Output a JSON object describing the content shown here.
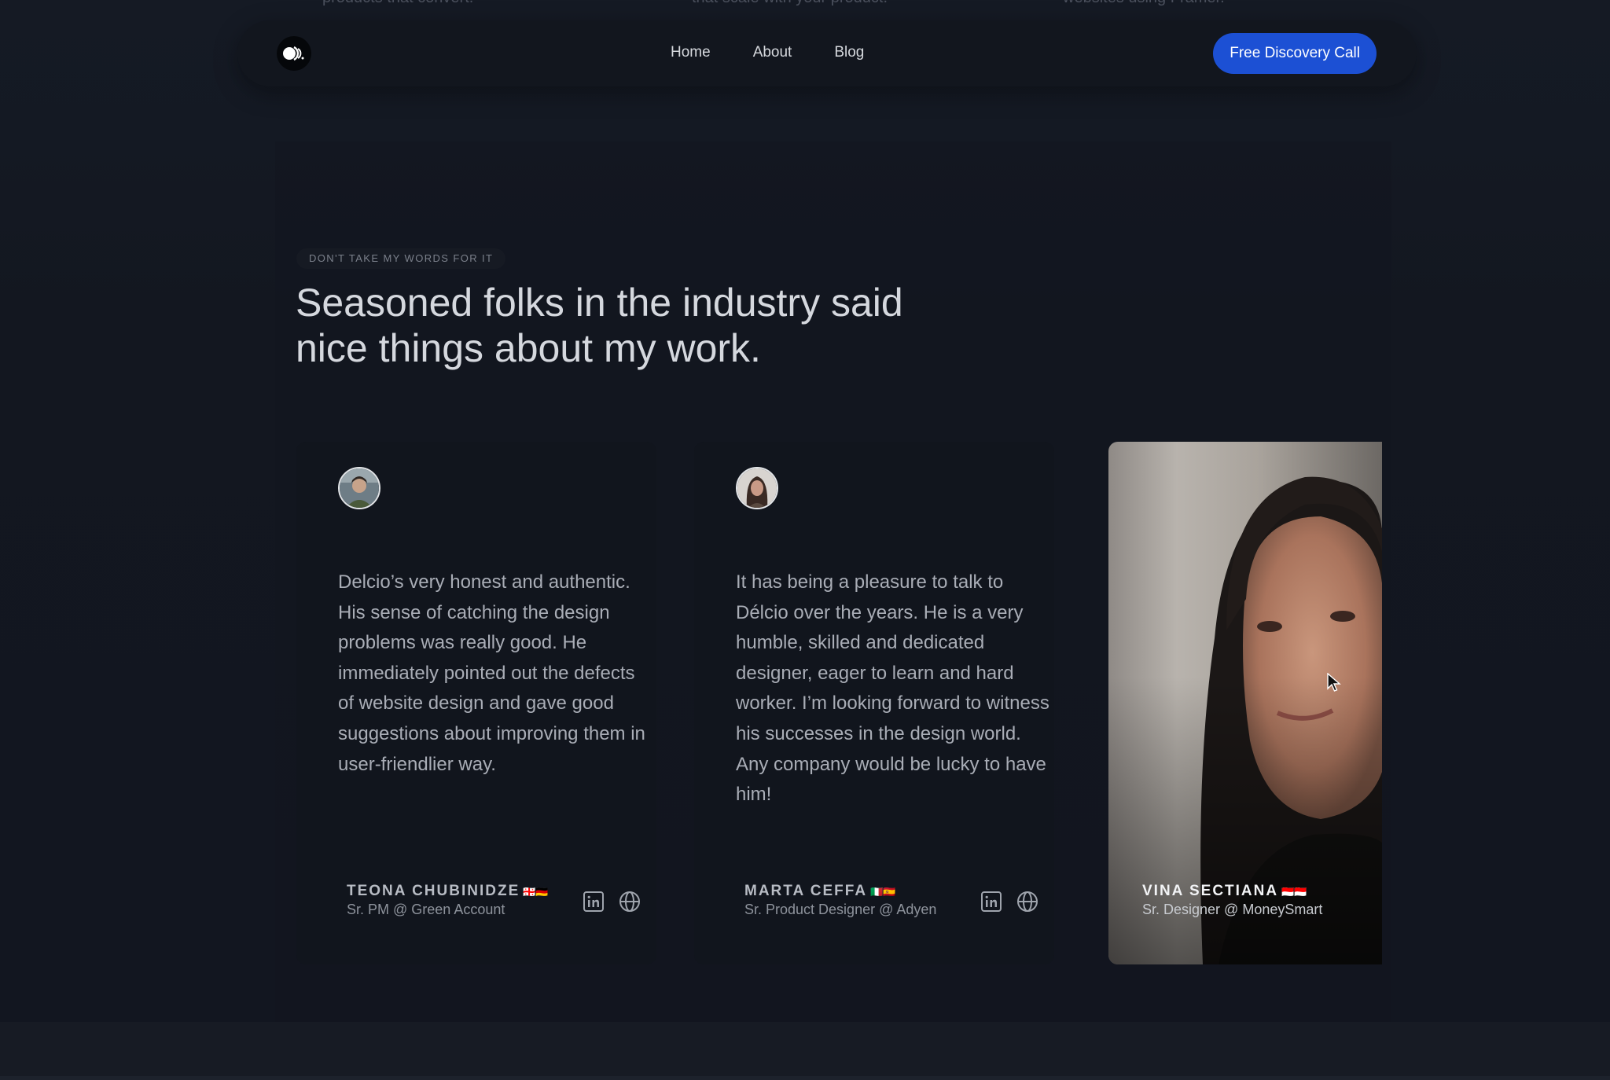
{
  "top_strip": {
    "text_1": "products that convert.",
    "text_2": "that scale with your product.",
    "text_3": "websites using Framer."
  },
  "nav": {
    "logo_icon": "brand-logo-icon",
    "links": [
      "Home",
      "About",
      "Blog"
    ],
    "cta_label": "Free Discovery Call",
    "cta_color": "#1c50d4"
  },
  "section": {
    "eyebrow": "DON'T TAKE MY WORDS FOR IT",
    "headline_line1": "Seasoned folks in the industry said",
    "headline_line2": "nice things about my work."
  },
  "testimonials": [
    {
      "quote": "Delcio’s very honest and authentic. His sense of catching the design problems was really good. He immediately pointed out the defects of website design and gave good suggestions about improving them in user-friendlier way.",
      "name": "TEONA CHUBINIDZE",
      "flags": "🇬🇪🇩🇪",
      "role": "Sr. PM @ Green Account",
      "icons": [
        "linkedin-icon",
        "globe-icon"
      ]
    },
    {
      "quote": "It has being a pleasure to talk to Délcio over the years. He is a very humble, skilled and dedicated designer, eager to learn and hard worker. I’m looking forward to witness his successes in the design world. Any company would be lucky to have him!",
      "name": "MARTA CEFFA",
      "flags": "🇮🇹🇪🇸",
      "role": "Sr. Product Designer @ Adyen",
      "icons": [
        "linkedin-icon",
        "globe-icon"
      ]
    },
    {
      "name": "VINA SECTIANA",
      "flags": "🇮🇩🇮🇩",
      "role": "Sr. Designer @ MoneySmart"
    }
  ]
}
